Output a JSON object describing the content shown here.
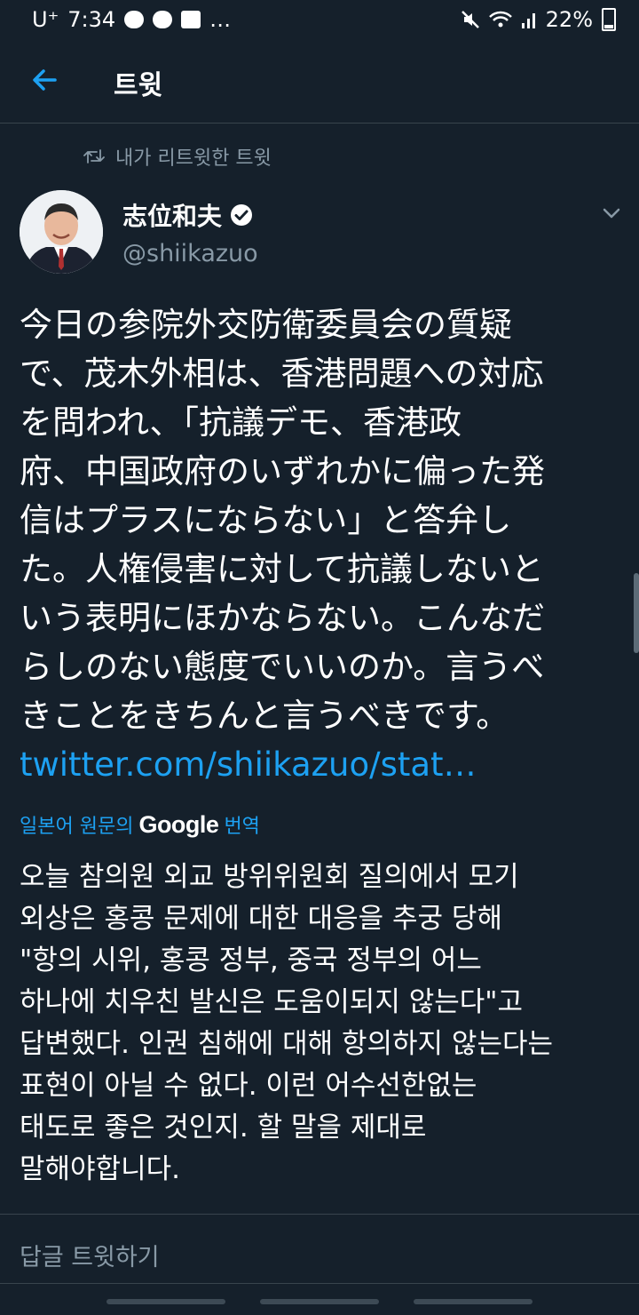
{
  "status_bar": {
    "carrier": "U⁺",
    "time": "7:34",
    "app_icons": [
      "kakaotalk-icon",
      "message-icon",
      "twitch-icon"
    ],
    "more": "…",
    "battery": "22%"
  },
  "header": {
    "title": "트윗",
    "back_icon": "back-arrow-icon"
  },
  "tweet": {
    "retweet_label": "내가 리트윗한 트윗",
    "author_name": "志位和夫",
    "handle": "@shiikazuo",
    "lines": [
      "今日の参院外交防衛委員会の質疑",
      "で、茂木外相は、香港問題への対応",
      "を問われ、「抗議デモ、香港政",
      "府、中国政府のいずれかに偏った発",
      "信はプラスにならない」と答弁し",
      "た。人権侵害に対して抗議しないと",
      "いう表明にほかならない。こんなだ",
      "らしのない態度でいいのか。言うべ",
      "きことをきちんと言うべきです。"
    ],
    "link": "twitter.com/shiikazuo/stat…",
    "translation": {
      "prefix": "일본어 원문의",
      "google": "Google",
      "suffix": "번역",
      "lines": [
        "오늘 참의원 외교 방위위원회 질의에서 모기",
        "외상은 홍콩 문제에 대한 대응을 추궁 당해",
        "\"항의 시위, 홍콩 정부, 중국 정부의 어느",
        "하나에 치우친 발신은 도움이되지 않는다\"고",
        "답변했다. 인권 침해에 대해 항의하지 않는다는",
        "표현이 아닐 수 없다. 이런 어수선한없는",
        "태도로 좋은 것인지. 할 말을 제대로",
        "말해야합니다."
      ]
    }
  },
  "reply": {
    "placeholder": "답글 트윗하기"
  },
  "colors": {
    "background": "#15202b",
    "accent": "#1da1f2",
    "muted": "#8899a6",
    "divider": "#38444d"
  }
}
